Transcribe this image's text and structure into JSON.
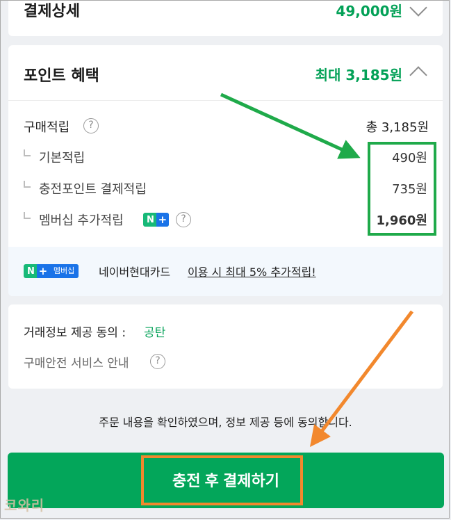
{
  "payment": {
    "title": "결제상세",
    "amount": "49,000원"
  },
  "points": {
    "title": "포인트 혜택",
    "max": "최대 3,185원",
    "purchase_label": "구매적립",
    "purchase_total": "총 3,185원",
    "items": [
      {
        "label": "기본적립",
        "value": "490원"
      },
      {
        "label": "충전포인트 결제적립",
        "value": "735원"
      },
      {
        "label": "멤버십 추가적립",
        "value": "1,960원"
      }
    ],
    "npay_badge": {
      "n": "N",
      "plus": "+",
      "membership": "멤버십"
    },
    "promo_prefix": "네이버현대카드",
    "promo_link": "이용 시 최대 5% 추가적립!"
  },
  "trade": {
    "consent_label": "거래정보 제공 동의 :",
    "consent_party": "공탄",
    "safety_label": "구매안전 서비스 안내"
  },
  "agree_text": "주문 내용을 확인하였으며, 정보 제공 등에 동의합니다.",
  "pay_button": "충전 후 결제하기",
  "help_glyph": "?",
  "watermark": "코와리",
  "colors": {
    "accent_green": "#03a65a",
    "price_green": "#03a157",
    "annotation_green": "#1faa4a",
    "annotation_orange": "#f2882d"
  }
}
